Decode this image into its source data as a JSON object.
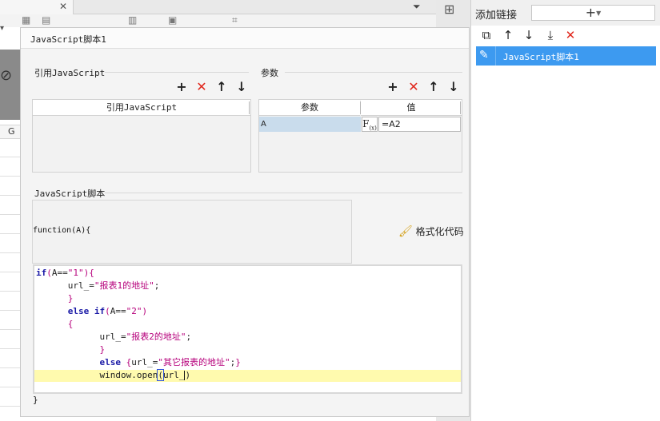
{
  "right_panel": {
    "title": "添加链接",
    "add_button": "+",
    "toolbar": [
      {
        "name": "copy",
        "glyph": "⧉"
      },
      {
        "name": "move-up",
        "glyph": "↑"
      },
      {
        "name": "move-down",
        "glyph": "↓"
      },
      {
        "name": "move-bottom",
        "glyph": "⤓"
      },
      {
        "name": "delete",
        "glyph": "✕"
      }
    ],
    "links": [
      {
        "label": "JavaScript脚本1",
        "selected": true
      }
    ],
    "accent": "#3d9af0"
  },
  "background": {
    "column_header": "G"
  },
  "dialog": {
    "title": "JavaScript脚本1",
    "import_section": {
      "title": "引用JavaScript",
      "column_header": "引用JavaScript"
    },
    "params_section": {
      "title": "参数",
      "columns": [
        "参数",
        "值"
      ],
      "rows": [
        {
          "name": "A",
          "formula_icon": "F(x)",
          "value": "=A2"
        }
      ]
    },
    "tool_glyphs": {
      "add": "+",
      "delete": "✕",
      "up": "↑",
      "down": "↓"
    },
    "script_section": {
      "title": "JavaScript脚本",
      "function_signature": "function(A){",
      "closing_brace": "}",
      "format_button": "格式化代码"
    },
    "code_lines": [
      "if(A==\"1\"){",
      "      url_=\"报表1的地址\";",
      "      }",
      "      else if(A==\"2\")",
      "      {",
      "            url_=\"报表2的地址\";",
      "            }",
      "            else {url_=\"其它报表的地址\";}",
      "            window.open(url_)"
    ]
  }
}
